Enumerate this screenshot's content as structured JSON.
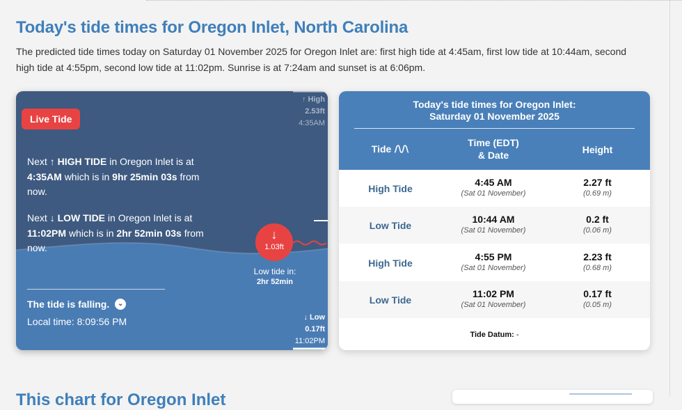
{
  "page": {
    "title": "Today's tide times for Oregon Inlet, North Carolina",
    "intro": "The predicted tide times today on Saturday 01 November 2025 for Oregon Inlet are: first high tide at 4:45am, first low tide at 10:44am, second high tide at 4:55pm, second low tide at 11:02pm. Sunrise is at 7:24am and sunset is at 6:06pm.",
    "next_section_title": "This chart for Oregon Inlet"
  },
  "live": {
    "badge": "Live Tide",
    "next_high": {
      "prefix": "Next",
      "arrow": "↑",
      "label": "HIGH TIDE",
      "mid": "in Oregon Inlet is at",
      "time": "4:35AM",
      "in_text": "which is in",
      "countdown": "9hr 25min 03s",
      "suffix": "from now."
    },
    "next_low": {
      "prefix": "Next",
      "arrow": "↓",
      "label": "LOW TIDE",
      "mid": "in Oregon Inlet is at",
      "time": "11:02PM",
      "in_text": "which is in",
      "countdown": "2hr 52min 03s",
      "suffix": "from now."
    },
    "status": "The tide is falling.",
    "local_time_label": "Local time:",
    "local_time": "8:09:56 PM",
    "scale_high": {
      "arrow": "↑",
      "label": "High",
      "height": "2.53ft",
      "time": "4:35AM"
    },
    "scale_low": {
      "arrow": "↓",
      "label": "Low",
      "height": "0.17ft",
      "time": "11:02PM"
    },
    "marker_arrow": "↓",
    "current_height": "1.03ft",
    "lowtide_in_label": "Low tide in:",
    "lowtide_in_value": "2hr 52min",
    "colors": {
      "badge": "#e84343",
      "water": "#4a7cb4",
      "sky": "#3e5a80"
    }
  },
  "table": {
    "title_line1": "Today's tide times for Oregon Inlet:",
    "title_line2": "Saturday 01 November 2025",
    "col_tide": "Tide",
    "col_tide_icon": "wave-icon",
    "col_time_line1": "Time (EDT)",
    "col_time_line2": "& Date",
    "col_height": "Height",
    "rows": [
      {
        "type": "High Tide",
        "time": "4:45 AM",
        "date": "(Sat 01 November)",
        "ft": "2.27 ft",
        "m": "(0.69 m)"
      },
      {
        "type": "Low Tide",
        "time": "10:44 AM",
        "date": "(Sat 01 November)",
        "ft": "0.2 ft",
        "m": "(0.06 m)"
      },
      {
        "type": "High Tide",
        "time": "4:55 PM",
        "date": "(Sat 01 November)",
        "ft": "2.23 ft",
        "m": "(0.68 m)"
      },
      {
        "type": "Low Tide",
        "time": "11:02 PM",
        "date": "(Sat 01 November)",
        "ft": "0.17 ft",
        "m": "(0.05 m)"
      }
    ],
    "datum_label": "Tide Datum:",
    "datum_value": "-",
    "colors": {
      "header": "#4a80b9",
      "tide_type": "#3d6891"
    }
  }
}
